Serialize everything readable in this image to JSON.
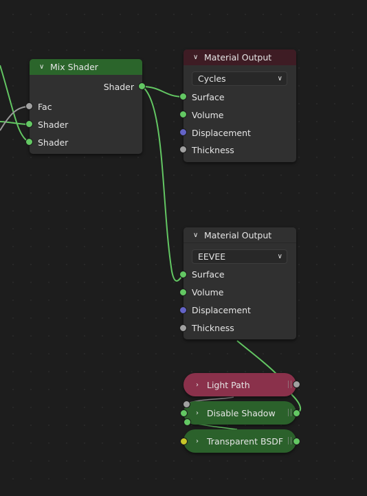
{
  "colors": {
    "background": "#1d1d1d",
    "node_body": "#303030",
    "shader_header": "#2b652b",
    "output_header": "#3e1c24",
    "input_header": "#8a314b",
    "shader_socket": "#63c763",
    "float_socket": "#a1a1a1",
    "vector_socket": "#6363c7",
    "color_socket": "#c7c729",
    "wire": "#63c763"
  },
  "mix_shader": {
    "title": "Mix Shader",
    "output": "Shader",
    "inputs": [
      "Fac",
      "Shader",
      "Shader"
    ]
  },
  "output_cycles": {
    "title": "Material Output",
    "target": "Cycles",
    "inputs": [
      "Surface",
      "Volume",
      "Displacement",
      "Thickness"
    ]
  },
  "output_eevee": {
    "title": "Material Output",
    "target": "EEVEE",
    "inputs": [
      "Surface",
      "Volume",
      "Displacement",
      "Thickness"
    ]
  },
  "collapsed": [
    {
      "title": "Light Path"
    },
    {
      "title": "Disable Shadow"
    },
    {
      "title": "Transparent BSDF"
    }
  ]
}
